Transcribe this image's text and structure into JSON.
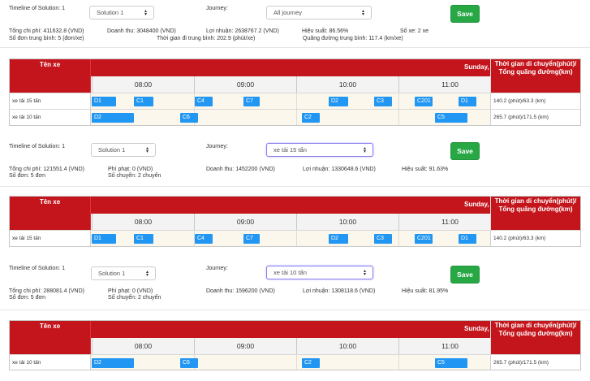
{
  "common": {
    "timeline_label": "Timeline of Solution: 1",
    "journey_label": "Journey:",
    "save_label": "Save",
    "solution_value": "Solution 1",
    "col_name": "Tên xe",
    "col_total": "Thời gian di chuyển(phút)/ Tổng quãng đường(km)",
    "date_text": "Sunday, Ju",
    "hours": [
      "08:00",
      "09:00",
      "10:00",
      "11:00"
    ]
  },
  "section1": {
    "journey_value": "All journey",
    "stats": {
      "tong_chi_phi": "Tổng chi phí: 411632.8 (VND)",
      "doanh_thu": "Doanh thu: 3048400 (VND)",
      "loi_nhuan": "Lợi nhuận: 2638767.2 (VND)",
      "hieu_suat": "Hiệu suất: 86.56%",
      "so_xe": "Số xe: 2 xe",
      "so_don_tb": "Số đơn trung bình: 5 (đơn/xe)",
      "tg_di_tb": "Thời gian đi trung bình: 202.9 (phút/xe)",
      "qd_tb": "Quãng đường trung bình: 117.4 (km/xe)"
    },
    "rows": [
      {
        "name": "xe tải 15 tấn",
        "total": "140.2 (phút)/63.3 (km)",
        "tasks": [
          [
            "D1",
            1,
            30
          ],
          [
            "C1",
            53,
            24
          ],
          [
            "C4",
            128,
            22
          ],
          [
            "C7",
            188,
            20
          ],
          [
            "D2",
            293,
            24
          ],
          [
            "C3",
            349,
            22
          ],
          [
            "C201",
            399,
            22
          ],
          [
            "D1",
            453,
            22
          ]
        ]
      },
      {
        "name": "xe tải 10 tấn",
        "total": "265.7 (phút)/171.5 (km)",
        "tasks": [
          [
            "D2",
            1,
            52
          ],
          [
            "C6",
            110,
            22
          ],
          [
            "C2",
            260,
            22
          ],
          [
            "C5",
            424,
            40
          ]
        ]
      }
    ]
  },
  "section2": {
    "journey_value": "xe tải 15 tấn",
    "stats": {
      "tong_chi_phi": "Tổng chi phí: 121551.4 (VND)",
      "phi_phat": "Phí phạt: 0 (VND)",
      "doanh_thu": "Doanh thu: 1452200 (VND)",
      "loi_nhuan": "Lợi nhuận: 1330648.6 (VND)",
      "hieu_suat": "Hiệu suất: 91.63%",
      "so_don": "Số đơn: 5 đơn",
      "so_chuyen": "Số chuyến: 2 chuyến"
    },
    "rows": [
      {
        "name": "xe tải 15 tấn",
        "total": "140.2 (phút)/63.3 (km)",
        "tasks": [
          [
            "D1",
            1,
            30
          ],
          [
            "C1",
            53,
            24
          ],
          [
            "C4",
            128,
            22
          ],
          [
            "C7",
            188,
            20
          ],
          [
            "D2",
            293,
            24
          ],
          [
            "C3",
            349,
            22
          ],
          [
            "C201",
            399,
            22
          ],
          [
            "D1",
            453,
            22
          ]
        ]
      }
    ]
  },
  "section3": {
    "journey_value": "xe tải 10 tấn",
    "stats": {
      "tong_chi_phi": "Tổng chi phí: 288081.4 (VND)",
      "phi_phat": "Phí phạt: 0 (VND)",
      "doanh_thu": "Doanh thu: 1596200 (VND)",
      "loi_nhuan": "Lợi nhuận: 1308118.6 (VND)",
      "hieu_suat": "Hiệu suất: 81.95%",
      "so_don": "Số đơn: 5 đơn",
      "so_chuyen": "Số chuyến: 2 chuyến"
    },
    "rows": [
      {
        "name": "xe tải 10 tấn",
        "total": "265.7 (phút)/171.5 (km)",
        "tasks": [
          [
            "D2",
            1,
            52
          ],
          [
            "C6",
            110,
            22
          ],
          [
            "C2",
            260,
            22
          ],
          [
            "C5",
            424,
            40
          ]
        ]
      }
    ]
  }
}
